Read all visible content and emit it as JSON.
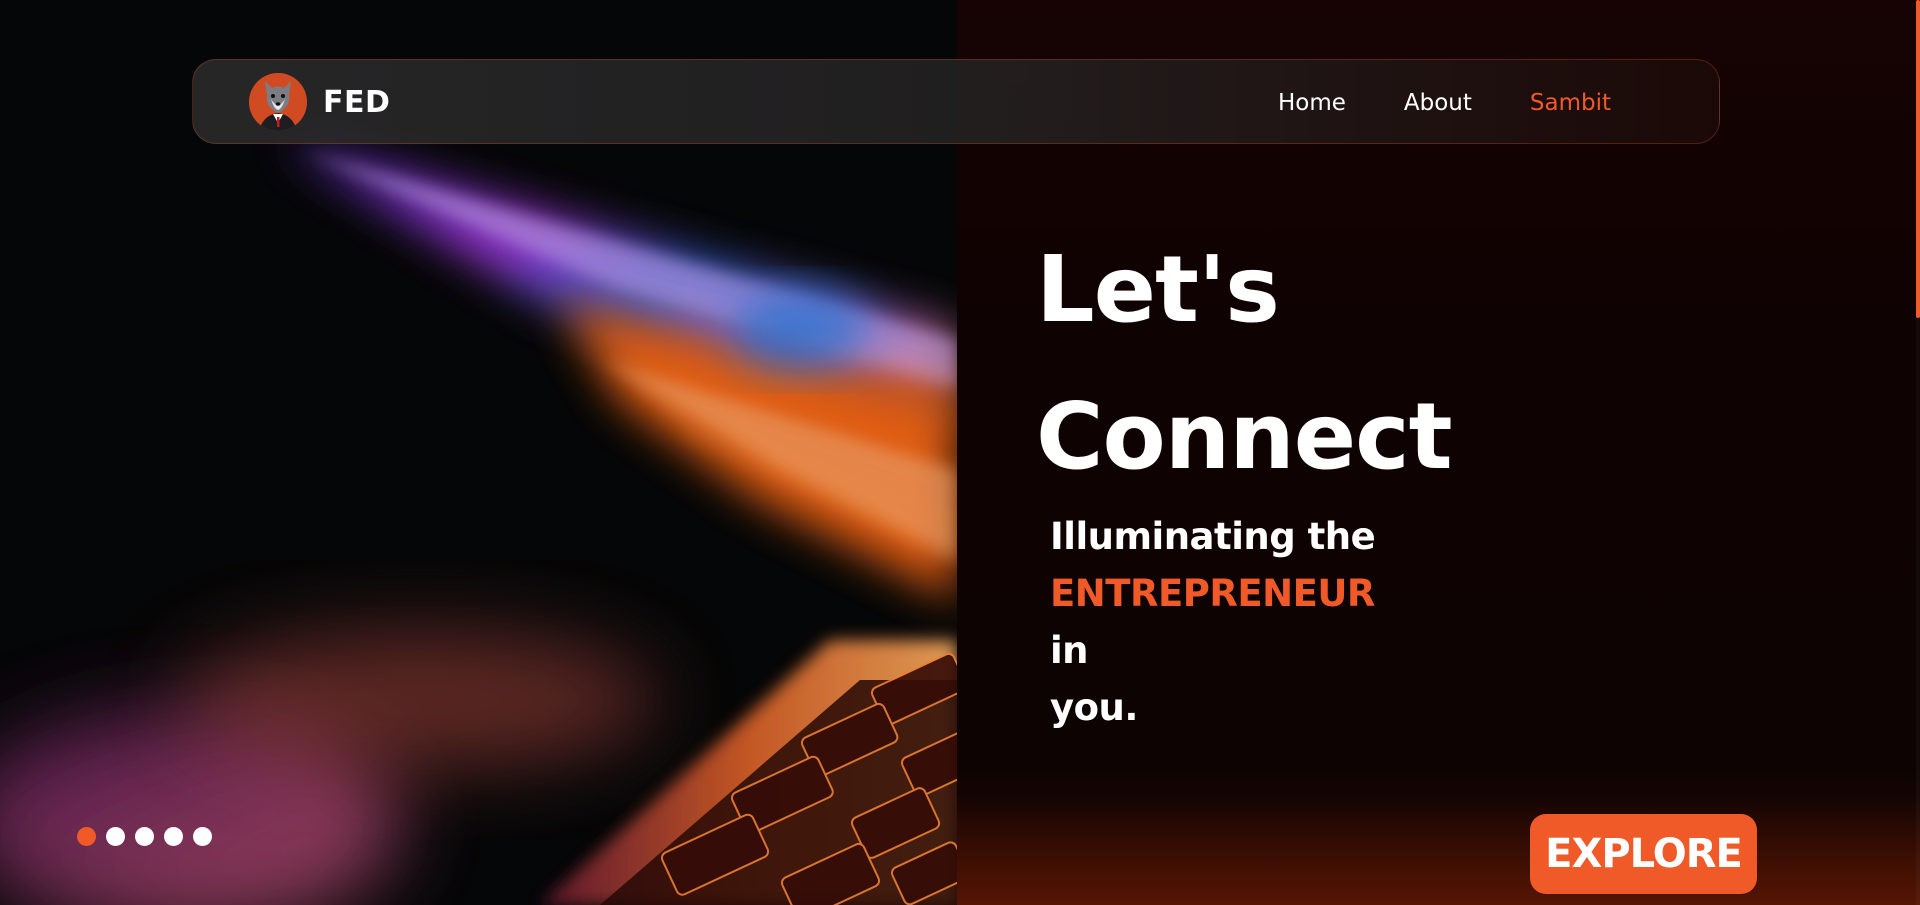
{
  "brand": {
    "name": "FED",
    "logo_icon": "wolf-mascot-icon"
  },
  "nav": {
    "items": [
      {
        "label": "Home",
        "active": false
      },
      {
        "label": "About",
        "active": false
      },
      {
        "label": "Sambit",
        "active": true
      }
    ]
  },
  "hero": {
    "headline_line1": "Let's",
    "headline_line2": "Connect",
    "tagline_prefix": "Illuminating the",
    "tagline_accent": "ENTREPRENEUR",
    "tagline_suffix": "in",
    "tagline_end": "you.",
    "cta_label": "EXPLORE",
    "image_subject": "laptop-keyboard-lit-screen"
  },
  "carousel": {
    "slide_count": 5,
    "active_index": 0
  },
  "colors": {
    "accent": "#f05a28",
    "background": "#0e0202",
    "text": "#ffffff"
  }
}
